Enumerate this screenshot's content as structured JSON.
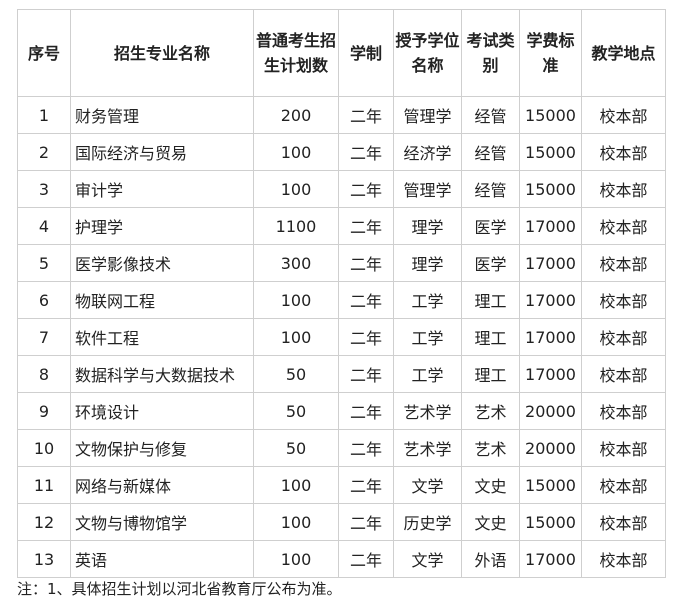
{
  "headers": {
    "seq": "序号",
    "major": "招生专业名称",
    "plan": "普通考生招生计划数",
    "duration": "学制",
    "degree": "授予学位名称",
    "exam_type": "考试类别",
    "tuition": "学费标准",
    "location": "教学地点"
  },
  "rows": [
    {
      "seq": "1",
      "major": "财务管理",
      "plan": "200",
      "duration": "二年",
      "degree": "管理学",
      "exam_type": "经管",
      "tuition": "15000",
      "location": "校本部"
    },
    {
      "seq": "2",
      "major": "国际经济与贸易",
      "plan": "100",
      "duration": "二年",
      "degree": "经济学",
      "exam_type": "经管",
      "tuition": "15000",
      "location": "校本部"
    },
    {
      "seq": "3",
      "major": "审计学",
      "plan": "100",
      "duration": "二年",
      "degree": "管理学",
      "exam_type": "经管",
      "tuition": "15000",
      "location": "校本部"
    },
    {
      "seq": "4",
      "major": "护理学",
      "plan": "1100",
      "duration": "二年",
      "degree": "理学",
      "exam_type": "医学",
      "tuition": "17000",
      "location": "校本部"
    },
    {
      "seq": "5",
      "major": "医学影像技术",
      "plan": "300",
      "duration": "二年",
      "degree": "理学",
      "exam_type": "医学",
      "tuition": "17000",
      "location": "校本部"
    },
    {
      "seq": "6",
      "major": "物联网工程",
      "plan": "100",
      "duration": "二年",
      "degree": "工学",
      "exam_type": "理工",
      "tuition": "17000",
      "location": "校本部"
    },
    {
      "seq": "7",
      "major": "软件工程",
      "plan": "100",
      "duration": "二年",
      "degree": "工学",
      "exam_type": "理工",
      "tuition": "17000",
      "location": "校本部"
    },
    {
      "seq": "8",
      "major": "数据科学与大数据技术",
      "plan": "50",
      "duration": "二年",
      "degree": "工学",
      "exam_type": "理工",
      "tuition": "17000",
      "location": "校本部"
    },
    {
      "seq": "9",
      "major": "环境设计",
      "plan": "50",
      "duration": "二年",
      "degree": "艺术学",
      "exam_type": "艺术",
      "tuition": "20000",
      "location": "校本部"
    },
    {
      "seq": "10",
      "major": "文物保护与修复",
      "plan": "50",
      "duration": "二年",
      "degree": "艺术学",
      "exam_type": "艺术",
      "tuition": "20000",
      "location": "校本部"
    },
    {
      "seq": "11",
      "major": "网络与新媒体",
      "plan": "100",
      "duration": "二年",
      "degree": "文学",
      "exam_type": "文史",
      "tuition": "15000",
      "location": "校本部"
    },
    {
      "seq": "12",
      "major": "文物与博物馆学",
      "plan": "100",
      "duration": "二年",
      "degree": "历史学",
      "exam_type": "文史",
      "tuition": "15000",
      "location": "校本部"
    },
    {
      "seq": "13",
      "major": "英语",
      "plan": "100",
      "duration": "二年",
      "degree": "文学",
      "exam_type": "外语",
      "tuition": "17000",
      "location": "校本部"
    }
  ],
  "note": "注：1、具体招生计划以河北省教育厅公布为准。"
}
